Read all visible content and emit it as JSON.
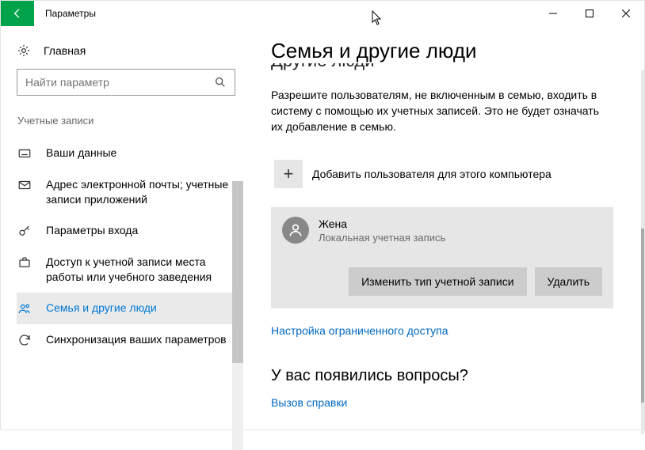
{
  "window": {
    "title": "Параметры"
  },
  "sidebar": {
    "home_label": "Главная",
    "search_placeholder": "Найти параметр",
    "section_label": "Учетные записи",
    "items": [
      {
        "label": "Ваши данные"
      },
      {
        "label": "Адрес электронной почты; учетные записи приложений"
      },
      {
        "label": "Параметры входа"
      },
      {
        "label": "Доступ к учетной записи места работы или учебного заведения"
      },
      {
        "label": "Семья и другие люди"
      },
      {
        "label": "Синхронизация ваших параметров"
      }
    ]
  },
  "main": {
    "heading": "Семья и другие люди",
    "cut_subheading": "Другие люди",
    "description": "Разрешите пользователям, не включенным в семью, входить в систему с помощью их учетных записей. Это не будет означать их добавление в семью.",
    "add_label": "Добавить пользователя для этого компьютера",
    "user": {
      "name": "Жена",
      "subtitle": "Локальная учетная запись",
      "change_type_btn": "Изменить тип учетной записи",
      "delete_btn": "Удалить"
    },
    "restricted_link": "Настройка ограниченного доступа",
    "question_heading": "У вас появились вопросы?",
    "help_link": "Вызов справки"
  }
}
